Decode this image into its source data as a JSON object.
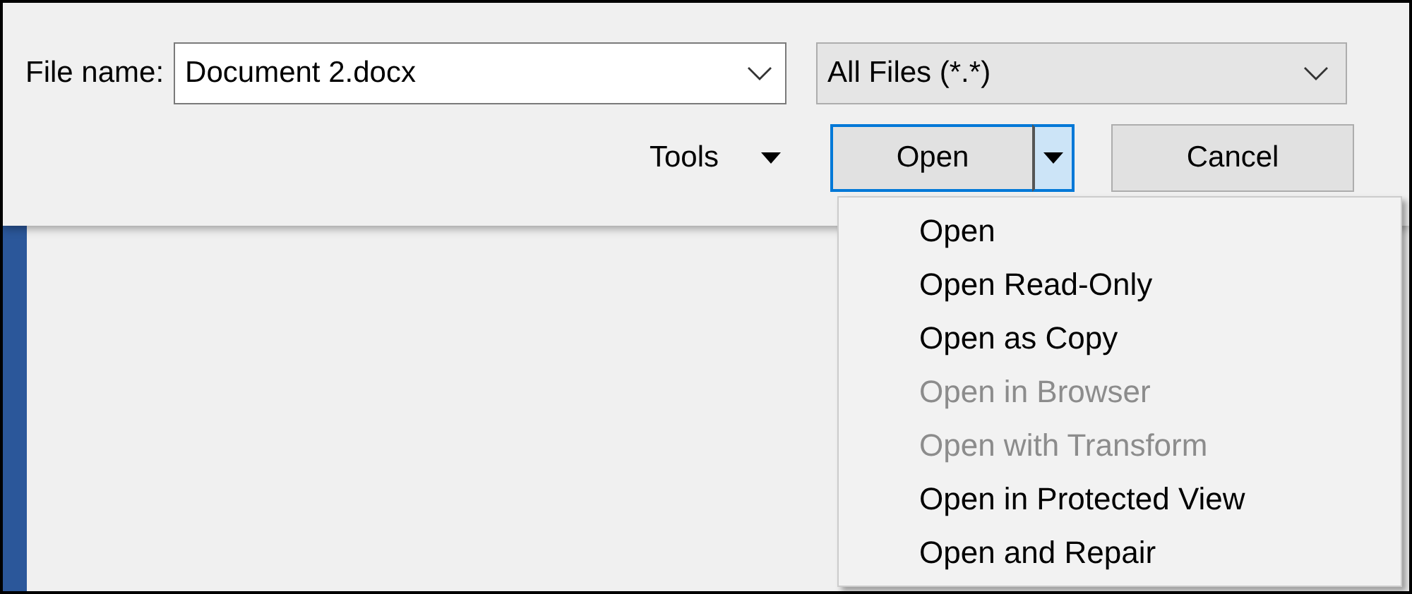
{
  "file_name": {
    "label": "File name:",
    "value": "Document 2.docx"
  },
  "file_type": {
    "value": "All Files (*.*)"
  },
  "tools": {
    "label": "Tools"
  },
  "buttons": [
    {
      "kind": "split",
      "label": "Open",
      "focused": true
    },
    {
      "kind": "plain",
      "label": "Cancel",
      "focused": false
    }
  ],
  "menu": {
    "items": [
      {
        "label": "Open",
        "disabled": false
      },
      {
        "label": "Open Read-Only",
        "disabled": false
      },
      {
        "label": "Open as Copy",
        "disabled": false
      },
      {
        "label": "Open in Browser",
        "disabled": true
      },
      {
        "label": "Open with Transform",
        "disabled": true
      },
      {
        "label": "Open in Protected View",
        "disabled": false
      },
      {
        "label": "Open and Repair",
        "disabled": false
      }
    ]
  }
}
